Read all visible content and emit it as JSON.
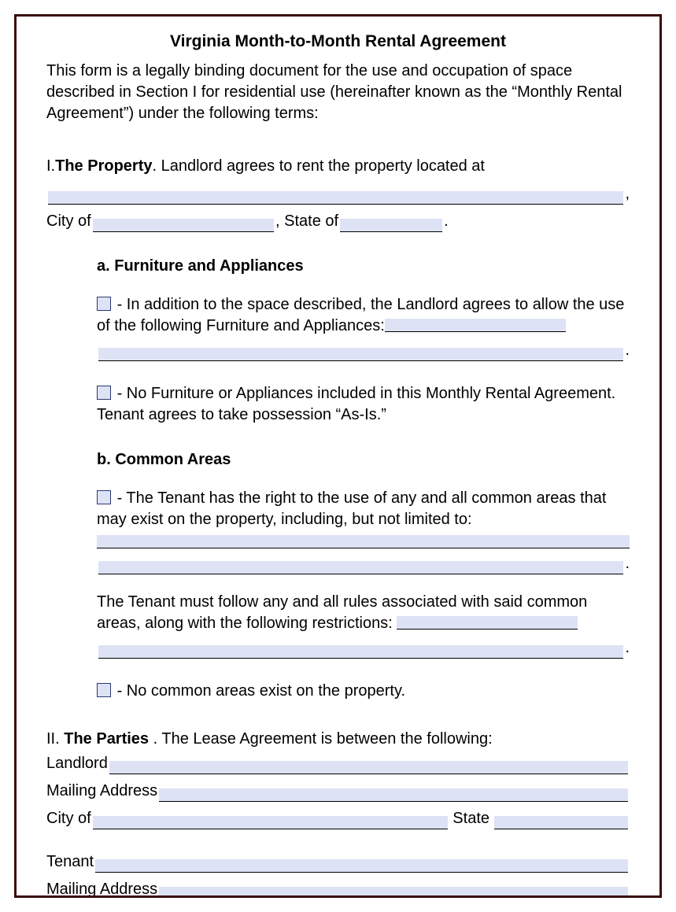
{
  "title": "Virginia Month-to-Month Rental Agreement",
  "intro": "This form is a legally binding document for the use and occupation of space described in Section I for residential use (hereinafter known as the “Monthly Rental Agreement”) under the following terms:",
  "section1": {
    "num": "I. ",
    "head": "The Property",
    "tail": ". Landlord agrees to rent the property located at",
    "city_label": "City of",
    "state_label": ", State of",
    "a": {
      "head": "a. Furniture and Appliances",
      "opt1": "- In addition to the space described, the Landlord agrees to allow the use of the following Furniture and Appliances:",
      "opt2": "- No Furniture or Appliances included in this Monthly Rental Agreement. Tenant agrees to take possession “As-Is.”"
    },
    "b": {
      "head": "b. Common Areas",
      "opt1": "- The Tenant has the right to the use of any and all common areas that may exist on the property, including, but not limited to:",
      "rules": "The Tenant must follow any and all rules associated with said common areas, along with the following restrictions:",
      "opt2": "- No common areas exist on the property."
    }
  },
  "section2": {
    "num": "II. ",
    "head": "The Parties",
    "tail": ". The Lease Agreement is between the following:",
    "landlord": "Landlord",
    "mailing": "Mailing Address",
    "city": "City of",
    "state": "State",
    "tenant": "Tenant"
  },
  "punct": {
    "comma": ",",
    "period": "."
  }
}
